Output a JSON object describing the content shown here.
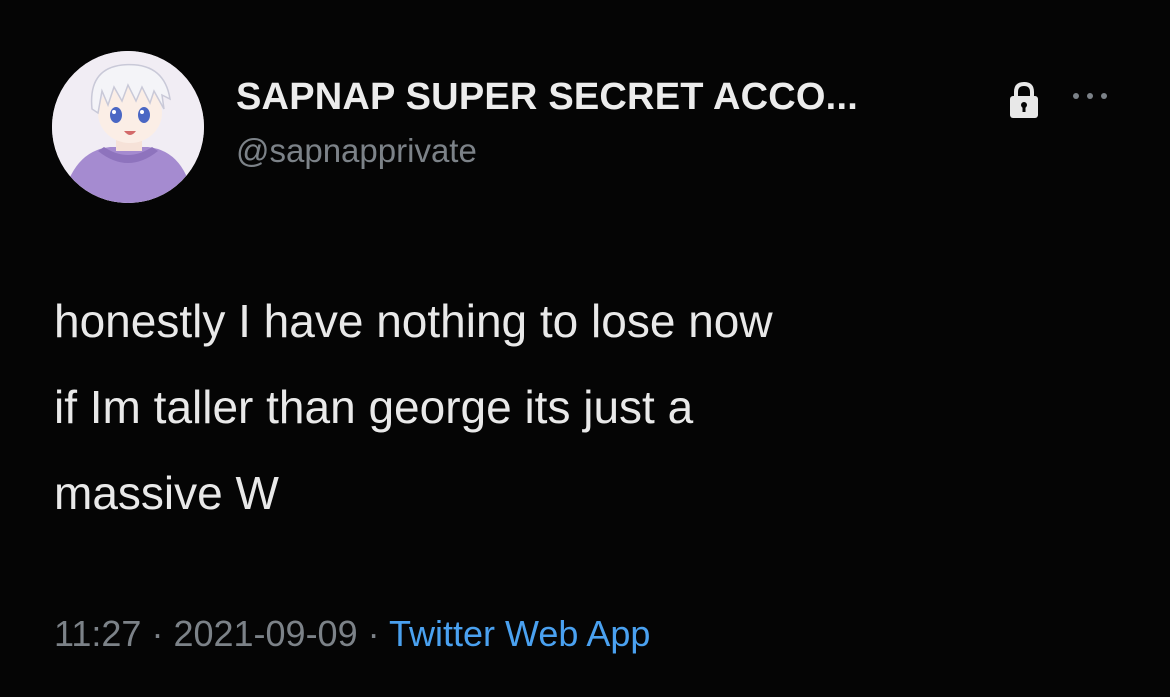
{
  "tweet": {
    "author": {
      "display_name": "SAPNAP SUPER SECRET ACCO...",
      "handle": "@sapnapprivate",
      "avatar_icon": "anime-avatar",
      "protected_icon": "lock-icon"
    },
    "more_icon": "more-icon",
    "text_lines": [
      "honestly I have nothing to lose now",
      "if Im taller than george its just a",
      "massive W"
    ],
    "time": "11:27",
    "separator": "·",
    "date": "2021-09-09",
    "source": "Twitter Web App"
  },
  "colors": {
    "background": "#050505",
    "text": "#e9e9e9",
    "muted": "#7c8288",
    "link": "#4aa1f0"
  }
}
